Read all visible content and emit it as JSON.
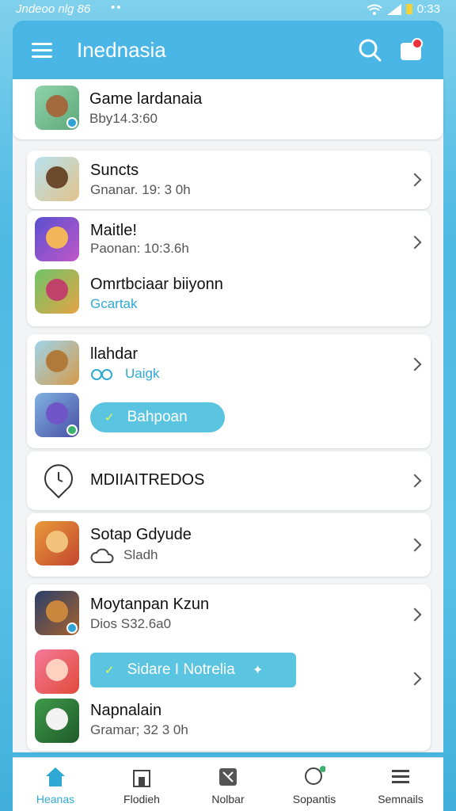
{
  "status": {
    "left": "Jndeoo nlg 86",
    "dots": "••",
    "time": "0:33"
  },
  "header": {
    "title": "Inednasia"
  },
  "items": [
    {
      "title": "Game lardanaia",
      "subtitle": "Bby14.3:60"
    },
    {
      "title": "Suncts",
      "subtitle": "Gnanar. 19: 3 0h"
    },
    {
      "title": "Maitle!",
      "subtitle": "Paonan: 10:3.6h"
    },
    {
      "title": "Omrtbciaar biiyonn",
      "subtitle": "Gcartak"
    },
    {
      "title": "llahdar",
      "subtitle": "Uaigk"
    },
    {
      "title": "",
      "pill": "Bahpoan"
    },
    {
      "title": "MDIIAITREDOS"
    },
    {
      "title": "Sotap Gdyude",
      "subtitle": "Sladh"
    },
    {
      "title": "Moytanpan Kzun",
      "subtitle": "Dios S32.6a0"
    },
    {
      "pill": "Sidare I Notrelia"
    },
    {
      "title": "Napnalain",
      "subtitle": "Gramar; 32 3 0h"
    }
  ],
  "nav": [
    {
      "label": "Heanas"
    },
    {
      "label": "Flodieh"
    },
    {
      "label": "Nolbar"
    },
    {
      "label": "Sopantis"
    },
    {
      "label": "Semnails"
    }
  ],
  "colors": {
    "accent": "#4ab6e6",
    "pill": "#5bc4e0",
    "badge": "#e8333d"
  }
}
